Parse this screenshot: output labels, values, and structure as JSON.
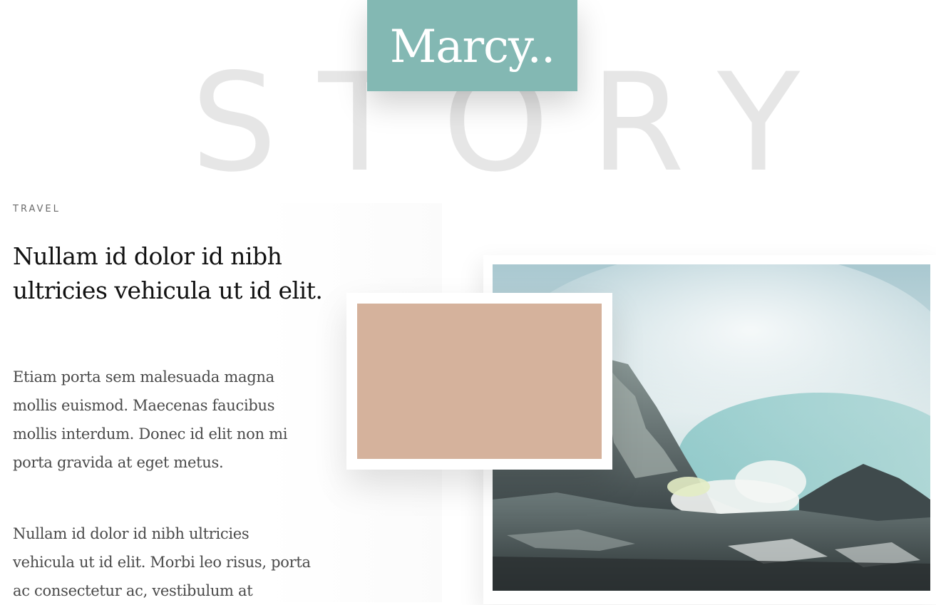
{
  "brand": {
    "logo_text": "Marcy..",
    "accent_color": "#83b8b3"
  },
  "hero": {
    "background_word": "STORY"
  },
  "article": {
    "category": "TRAVEL",
    "headline": "Nullam id dolor id nibh ultricies vehicula ut id elit.",
    "paragraphs": [
      "Etiam porta sem malesuada magna mollis euismod. Maecenas faucibus mollis interdum. Donec id elit non mi porta gravida at eget metus.",
      "Nullam id dolor id nibh ultricies vehicula ut id elit. Morbi leo risus, porta ac consectetur ac, vestibulum at"
    ]
  },
  "media": {
    "swatch_color": "#d5b29c",
    "photo_icon": "mountain-landscape-photo"
  }
}
